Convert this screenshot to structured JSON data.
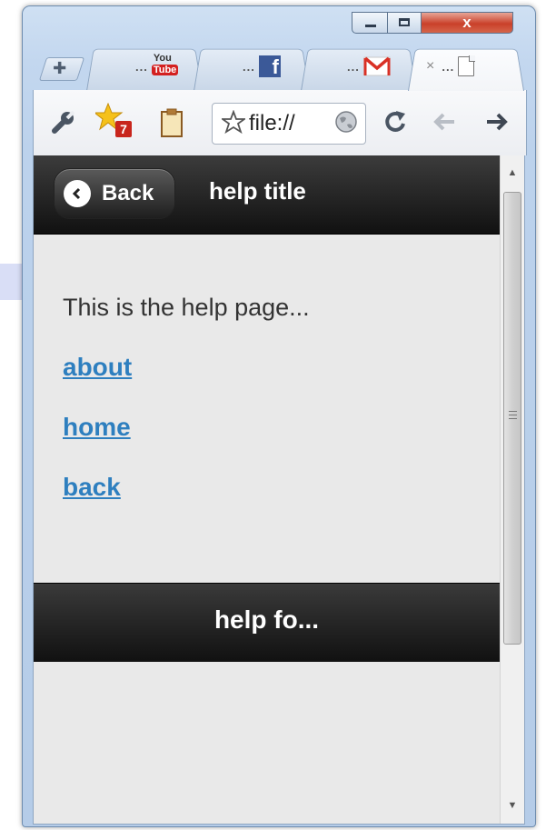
{
  "window": {
    "controls": {
      "close_glyph": "x"
    }
  },
  "tabs": [
    {
      "name": "youtube",
      "dots": "...",
      "icon": "youtube-icon",
      "icon_text_top": "You",
      "icon_text_bottom": "Tube",
      "active": false
    },
    {
      "name": "facebook",
      "dots": "...",
      "icon": "facebook-icon",
      "icon_text": "f",
      "active": false
    },
    {
      "name": "gmail",
      "dots": "...",
      "icon": "gmail-icon",
      "active": false
    },
    {
      "name": "local-file",
      "dots": "...",
      "icon": "document-icon",
      "close_glyph": "×",
      "active": true
    }
  ],
  "toolbar": {
    "address": "file://",
    "extension_badge": "7"
  },
  "page": {
    "header": {
      "back_label": "Back",
      "title": "help title"
    },
    "intro": "This is the help page...",
    "links": [
      "about",
      "home",
      "back"
    ],
    "footer": {
      "title": "help fo..."
    }
  },
  "colors": {
    "bar_dark": "#1a1a1a",
    "link": "#2e7fbf",
    "page_background": "#e9e9e9",
    "close_red": "#c9402a"
  }
}
